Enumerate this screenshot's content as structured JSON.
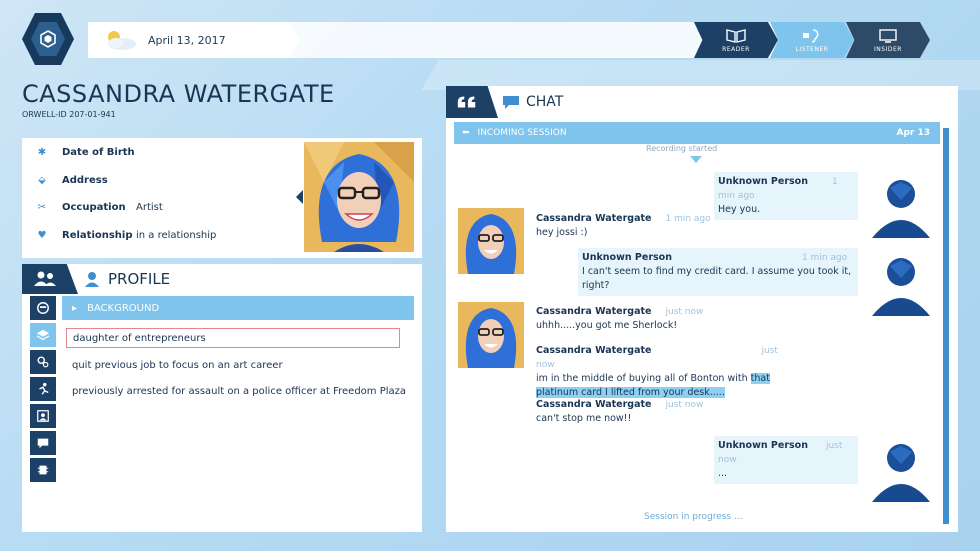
{
  "header": {
    "date": "April 13, 2017",
    "modes": [
      {
        "label": "READER"
      },
      {
        "label": "LISTENER"
      },
      {
        "label": "INSIDER"
      }
    ]
  },
  "subject": {
    "name": "CASSANDRA WATERGATE",
    "orwell_id_label": "ORWELL-ID",
    "orwell_id": "207-01-941",
    "details": [
      {
        "label": "Date of Birth",
        "value": ""
      },
      {
        "label": "Address",
        "value": ""
      },
      {
        "label": "Occupation",
        "value": "Artist"
      },
      {
        "label": "Relationship",
        "value": "in a relationship"
      }
    ]
  },
  "profile": {
    "title": "PROFILE",
    "category": "BACKGROUND",
    "facts": [
      "daughter of entrepreneurs",
      "quit previous job to focus on an art career",
      "previously arrested for assault on a police officer at Freedom Plaza"
    ]
  },
  "chat": {
    "title": "CHAT",
    "session_label": "INCOMING SESSION",
    "session_date": "Apr 13",
    "recording": "Recording started",
    "messages": [
      {
        "sender": "Unknown Person",
        "time": "1 min ago",
        "text": "Hey you."
      },
      {
        "sender": "Cassandra Watergate",
        "time": "1 min ago",
        "text": "hey jossi :)"
      },
      {
        "sender": "Unknown Person",
        "time": "1 min ago",
        "text1": "I can't seem to find my credit card. I assume you took it,",
        "text2": "right?"
      },
      {
        "sender": "Cassandra Watergate",
        "time": "just now",
        "text": "uhhh.....you got me Sherlock!"
      },
      {
        "sender": "Cassandra Watergate",
        "time": "just now",
        "text1": "im in the middle of buying all of Bonton with ",
        "hl1": "that",
        "hl2": "platinum card I lifted from your desk....."
      },
      {
        "sender": "Cassandra Watergate",
        "time": "just now",
        "text": "can't stop me now!!"
      },
      {
        "sender": "Unknown Person",
        "time": "just now",
        "text": "..."
      }
    ],
    "status": "Session in progress ..."
  },
  "colors": {
    "navy": "#1d4066",
    "light_blue": "#7ec4ec",
    "accent": "#3f8fd0"
  }
}
